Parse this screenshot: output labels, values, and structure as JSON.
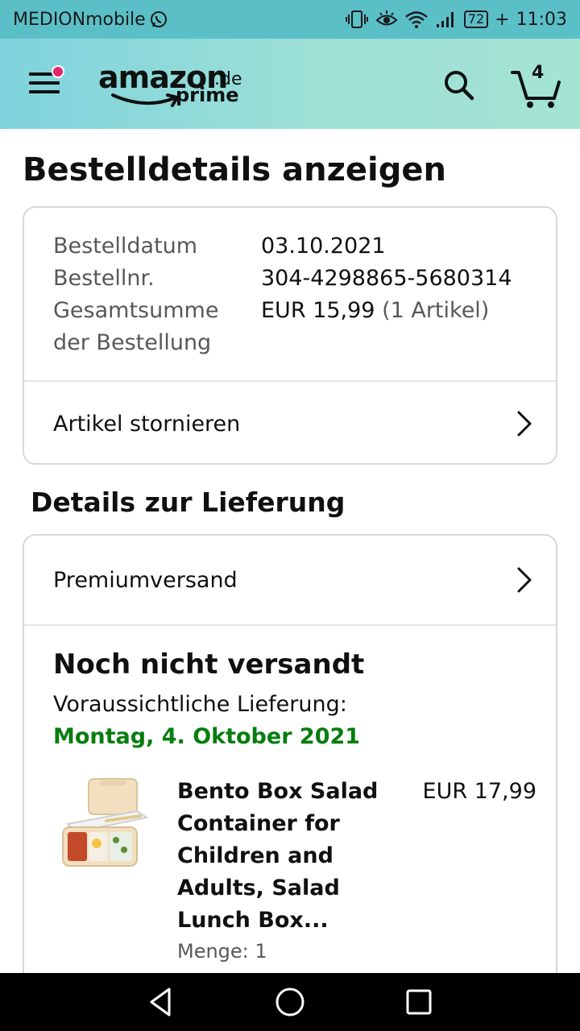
{
  "status_bar": {
    "carrier": "MEDIONmobile",
    "battery": "72",
    "time": "11:03"
  },
  "header": {
    "logo_word": "amazon",
    "logo_tld": ".de",
    "logo_sub": "prime",
    "cart_count": "4",
    "menu_badge_color": "#e3256b"
  },
  "page": {
    "title": "Bestelldetails anzeigen"
  },
  "order": {
    "date_label": "Bestelldatum",
    "date_value": "03.10.2021",
    "number_label": "Bestellnr.",
    "number_value": "304-4298865-5680314",
    "total_label_1": "Gesamtsumme",
    "total_label_2": "der Bestellung",
    "total_value": "EUR 15,99",
    "total_items": "(1 Artikel)",
    "cancel_label": "Artikel stornieren"
  },
  "delivery": {
    "section_title": "Details zur Lieferung",
    "shipping_method": "Premiumversand",
    "status": "Noch nicht versandt",
    "expected_label": "Voraussichtliche Lieferung:",
    "expected_date": "Montag, 4. Oktober 2021",
    "expected_date_color": "#067d0e"
  },
  "item": {
    "title": "Bento Box Salad Container for Children and Adults, Salad Lunch Box...",
    "price": "EUR 17,99",
    "quantity": "Menge: 1",
    "image_icon": "bento-box-icon"
  },
  "nav_bar": {
    "back_icon": "back-triangle-icon",
    "home_icon": "home-circle-icon",
    "recents_icon": "recents-square-icon"
  }
}
